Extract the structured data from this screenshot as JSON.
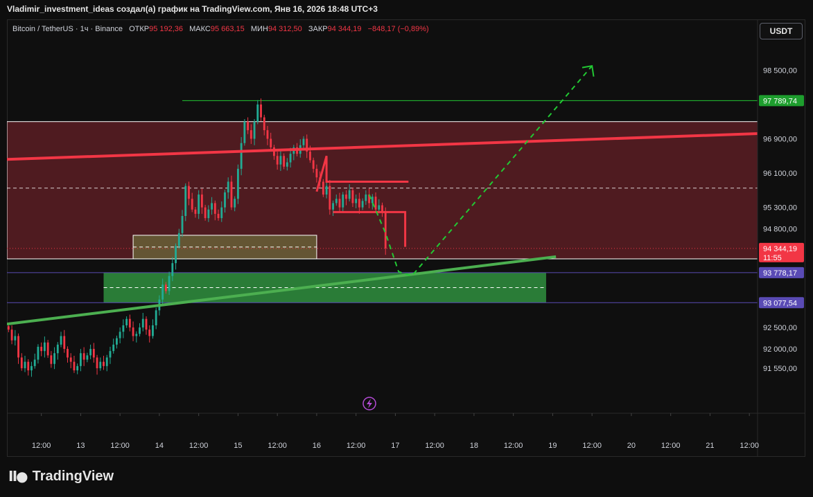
{
  "header": {
    "title": "Vladimir_investment_ideas создал(а) график на TradingView.com, Янв 16, 2026 18:48 UTC+3"
  },
  "info_bar": {
    "symbol": "Bitcoin / TetherUS · 1ч · Binance",
    "open_label": "ОТКР",
    "open_value": "95 192,36",
    "high_label": "МАКС",
    "high_value": "95 663,15",
    "low_label": "МИН",
    "low_value": "94 312,50",
    "close_label": "ЗАКР",
    "close_value": "94 344,19",
    "change": "−848,17 (−0,89%)"
  },
  "currency_button": "USDT",
  "footer": {
    "brand": "TradingView",
    "logo_icon": "tradingview-logo-icon"
  },
  "colors": {
    "up": "#22ab94",
    "down": "#f23645",
    "resistance_zone": "#5b1d23",
    "support_zone": "#2f8f3e",
    "projection": "#22c833",
    "price_label": "#f23645",
    "level_label_purple": "#5a4bb5",
    "level_label_green": "#1e9e2e"
  },
  "chart_data": {
    "type": "candlestick",
    "title": "",
    "xlabel": "",
    "ylabel": "",
    "y_ticks": [
      "98 500,00",
      "96 900,00",
      "96 100,00",
      "95 300,00",
      "94 800,00",
      "92 500,00",
      "92 000,00",
      "91 550,00"
    ],
    "y_tick_values": [
      98500,
      96900,
      96100,
      95300,
      94800,
      92500,
      92000,
      91550
    ],
    "x_ticks": [
      "12:00",
      "13",
      "12:00",
      "14",
      "12:00",
      "15",
      "12:00",
      "16",
      "12:00",
      "17",
      "12:00",
      "18",
      "12:00",
      "19",
      "12:00",
      "20",
      "12:00",
      "21",
      "12:00"
    ],
    "x_tick_hours": [
      12,
      24,
      36,
      48,
      60,
      72,
      84,
      96,
      108,
      120,
      132,
      144,
      156,
      168,
      180,
      192,
      204,
      216,
      228
    ],
    "x_range_hours": [
      1.5,
      230.5
    ],
    "y_range": [
      90500,
      99200
    ],
    "x_unit": "hours since Jan 12 00:00",
    "last_price": {
      "value": 94344.19,
      "label": "94 344,19",
      "countdown": "11:55"
    },
    "levels": [
      {
        "name": "target",
        "value": 97789.74,
        "label": "97 789,74",
        "style": "green"
      },
      {
        "name": "support-top",
        "value": 93778.17,
        "label": "93 778,17",
        "style": "purple"
      },
      {
        "name": "support-bottom",
        "value": 93077.54,
        "label": "93 077,54",
        "style": "purple"
      }
    ],
    "closes": [
      92450,
      92200,
      92300,
      91800,
      91550,
      91700,
      91500,
      91600,
      91750,
      92050,
      91950,
      92150,
      91850,
      91650,
      91900,
      92100,
      92300,
      92000,
      91800,
      91700,
      91500,
      91600,
      91900,
      91750,
      91850,
      92000,
      91800,
      91550,
      91700,
      91600,
      91800,
      91950,
      92100,
      92250,
      92400,
      92550,
      92700,
      92500,
      92300,
      92350,
      92500,
      92700,
      92450,
      92300,
      92550,
      92900,
      93150,
      93500,
      93350,
      93700,
      94000,
      94400,
      94700,
      95100,
      95800,
      95500,
      95250,
      95150,
      95600,
      95300,
      95050,
      95250,
      95400,
      95150,
      95050,
      95300,
      95650,
      95900,
      95300,
      95500,
      96200,
      96800,
      97300,
      97100,
      96900,
      97300,
      97700,
      97400,
      97100,
      96900,
      96700,
      96500,
      96300,
      96500,
      96250,
      96350,
      96550,
      96700,
      96550,
      96750,
      96900,
      96600,
      96400,
      96200,
      96000,
      95900,
      95600,
      95800,
      95250,
      95400,
      95500,
      95300,
      95600,
      95500,
      95700,
      95400,
      95500,
      95300,
      95450,
      95600,
      95400,
      95550,
      95250,
      95350,
      95200,
      94344
    ]
  },
  "annotations": {
    "resistance_zone": [
      94100,
      97300
    ],
    "support_zone": [
      93080,
      93780
    ],
    "entry_box": [
      94100,
      94650
    ]
  }
}
